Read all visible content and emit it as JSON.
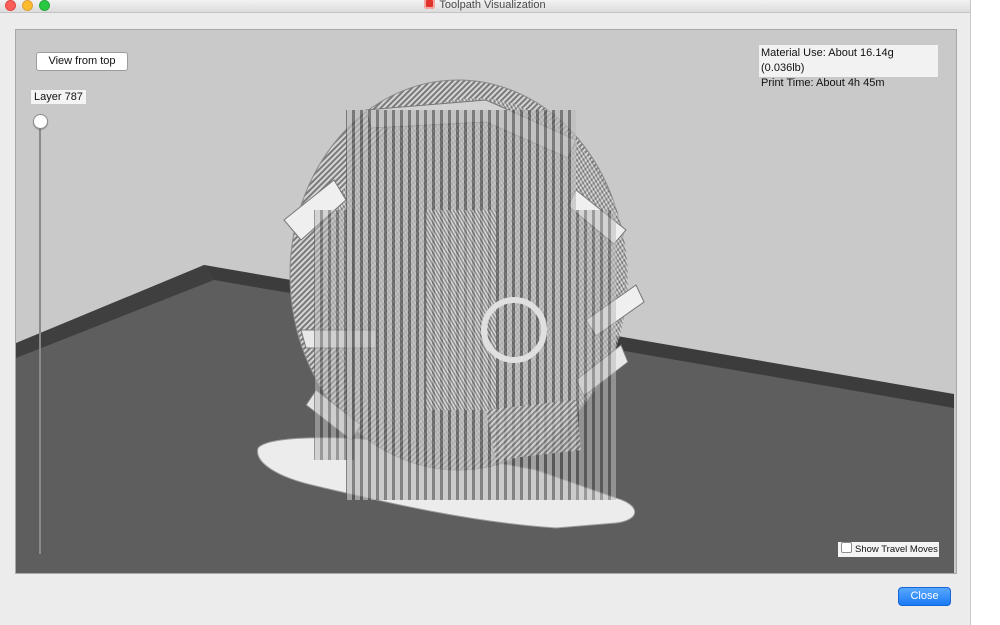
{
  "window": {
    "title": "Toolpath Visualization"
  },
  "viewport": {
    "view_from_top_label": "View from top",
    "layer_label": "Layer 787",
    "layer_slider_value": 1.0,
    "material_use": "Material Use: About 16.14g (0.036lb)",
    "print_time": "Print Time: About 4h 45m",
    "show_travel_moves_label": "Show Travel Moves",
    "show_travel_moves_checked": false
  },
  "footer": {
    "close_label": "Close"
  },
  "colors": {
    "background_wall": "#c9c9c9",
    "build_plate": "#5e5e5e",
    "plate_edge": "#3c3c3c",
    "model_light": "#d9d9d9",
    "model_dark": "#6d6d6d",
    "accent_button": "#1a7af5"
  }
}
